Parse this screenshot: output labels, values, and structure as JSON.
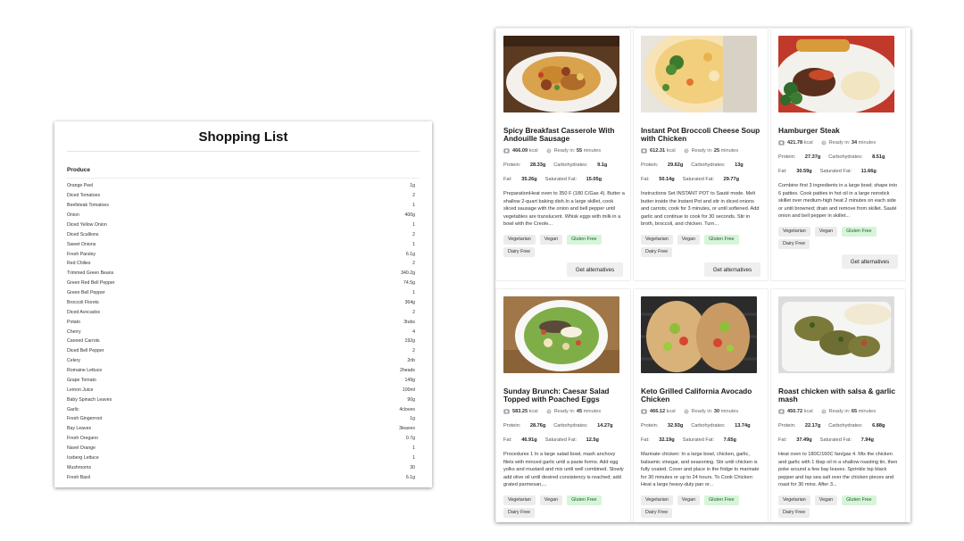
{
  "shopping_list": {
    "title": "Shopping List",
    "category": "Produce",
    "items": [
      {
        "name": "Orange Peel",
        "qty": "1g"
      },
      {
        "name": "Diced Tomatoes",
        "qty": "2"
      },
      {
        "name": "Beefsteak Tomatoes",
        "qty": "1"
      },
      {
        "name": "Onion",
        "qty": "400g"
      },
      {
        "name": "Diced Yellow Onion",
        "qty": "1"
      },
      {
        "name": "Diced Scallions",
        "qty": "2"
      },
      {
        "name": "Sweet Onions",
        "qty": "1"
      },
      {
        "name": "Fresh Parsley",
        "qty": "6.1g"
      },
      {
        "name": "Red Chilies",
        "qty": "2"
      },
      {
        "name": "Trimmed Green Beans",
        "qty": "340.2g"
      },
      {
        "name": "Green Red Bell Pepper",
        "qty": "74.5g"
      },
      {
        "name": "Green Bell Pepper",
        "qty": "1"
      },
      {
        "name": "Broccoli Florets",
        "qty": "364g"
      },
      {
        "name": "Diced Avocados",
        "qty": "2"
      },
      {
        "name": "Potato",
        "qty": "3tubs"
      },
      {
        "name": "Cherry",
        "qty": "4"
      },
      {
        "name": "Canned Carrots",
        "qty": "192g"
      },
      {
        "name": "Diced Bell Pepper",
        "qty": "2"
      },
      {
        "name": "Celery",
        "qty": "2rib"
      },
      {
        "name": "Romaine Lettuce",
        "qty": "2heads"
      },
      {
        "name": "Grape Tomato",
        "qty": "149g"
      },
      {
        "name": "Lemon Juice",
        "qty": "100ml"
      },
      {
        "name": "Baby Spinach Leaves",
        "qty": "90g"
      },
      {
        "name": "Garlic",
        "qty": "4cloves"
      },
      {
        "name": "Fresh Gingerroot",
        "qty": "1g"
      },
      {
        "name": "Bay Leaves",
        "qty": "3leaves"
      },
      {
        "name": "Fresh Oregano",
        "qty": "0.7g"
      },
      {
        "name": "Navel Orange",
        "qty": "1"
      },
      {
        "name": "Iceberg Lettuce",
        "qty": "1"
      },
      {
        "name": "Mushrooms",
        "qty": "30"
      },
      {
        "name": "Fresh Basil",
        "qty": "6.1g"
      }
    ]
  },
  "labels": {
    "ready_in": "Ready in:",
    "minutes": "minutes",
    "kcal": "kcal",
    "protein": "Protein:",
    "carbs": "Carbohydrates:",
    "fat": "Fat:",
    "sat_fat": "Saturated Fat:",
    "alternatives": "Get alternatives"
  },
  "recipes": [
    {
      "title": "Spicy Breakfast Casserole With Andouille Sausage",
      "kcal": "466.09",
      "ready": "55",
      "protein": "28.33g",
      "carbs": "9.1g",
      "fat": "35.26g",
      "sat_fat": "15.05g",
      "description": "PreparationHeat oven to 350 F (180 C/Gas 4). Butter a shallow 2-quart baking dish.In a large skillet, cook sliced sausage with the onion and bell pepper until vegetables are translucent. Whisk eggs with milk in a bowl with the Creole...",
      "tags": [
        "Vegetarian",
        "Vegan",
        "Gluten Free",
        "Dairy Free"
      ],
      "image": "casserole"
    },
    {
      "title": "Instant Pot Broccoli Cheese Soup with Chicken",
      "kcal": "612.31",
      "ready": "25",
      "protein": "29.62g",
      "carbs": "13g",
      "fat": "50.14g",
      "sat_fat": "29.77g",
      "description": "Instructions Set INSTANT POT to Sauté mode. Melt butter inside the Instant Pot and stir in diced onions and carrots; cook for 3 minutes, or until softened. Add garlic and continue to cook for 30 seconds. Stir in broth, broccoli, and chicken. Turn...",
      "tags": [
        "Vegetarian",
        "Vegan",
        "Gluten Free",
        "Dairy Free"
      ],
      "image": "soup"
    },
    {
      "title": "Hamburger Steak",
      "kcal": "421.78",
      "ready": "34",
      "protein": "27.37g",
      "carbs": "8.51g",
      "fat": "30.59g",
      "sat_fat": "11.66g",
      "description": "Combine first 3 ingredients in a large bowl; shape into 6 patties. Cook patties in hot oil in a large nonstick skillet over medium-high heat 2 minutes on each side or until browned; drain and remove from skillet. Sauté onion and bell pepper in skillet...",
      "tags": [
        "Vegetarian",
        "Vegan",
        "Gluten Free",
        "Dairy Free"
      ],
      "image": "steak"
    },
    {
      "title": "Sunday Brunch: Caesar Salad Topped with Poached Eggs",
      "kcal": "583.25",
      "ready": "45",
      "protein": "28.76g",
      "carbs": "14.27g",
      "fat": "46.91g",
      "sat_fat": "12.5g",
      "description": "Procedures 1 In a large salad bowl, mash anchovy filets with minced garlic until a paste forms. Add egg yolks and mustard and mix until well combined. Slowly add olive oil until desired consistency is reached; add grated parmesan,...",
      "tags": [
        "Vegetarian",
        "Vegan",
        "Gluten Free",
        "Dairy Free"
      ],
      "image": "salad"
    },
    {
      "title": "Keto Grilled California Avocado Chicken",
      "kcal": "466.12",
      "ready": "30",
      "protein": "32.93g",
      "carbs": "13.74g",
      "fat": "32.19g",
      "sat_fat": "7.65g",
      "description": "Marinate chicken: In a large bowl, chicken, garlic, balsamic vinegar, and seasoning. Stir until chicken is fully coated. Cover and place in the fridge to marinate for 30 minutes or up to 24 hours. To Cook Chicken: Heat a large heavy-duty pan or...",
      "tags": [
        "Vegetarian",
        "Vegan",
        "Gluten Free",
        "Dairy Free"
      ],
      "image": "avocado"
    },
    {
      "title": "Roast chicken with salsa & garlic mash",
      "kcal": "450.72",
      "ready": "65",
      "protein": "22.17g",
      "carbs": "6.88g",
      "fat": "37.49g",
      "sat_fat": "7.94g",
      "description": "Heat oven to 180C/160C fan/gas 4. Mix the chicken and garlic with 1 tbsp oil in a shallow roasting tin, then poke around a few bay leaves. Sprinkle tsp black pepper and tsp sea salt over the chicken pieces and roast for 30 mins. After 3...",
      "tags": [
        "Vegetarian",
        "Vegan",
        "Gluten Free",
        "Dairy Free"
      ],
      "image": "roast"
    }
  ],
  "colors": {
    "tag_bg": "#ececec",
    "tag_green_bg": "#d6f5d9",
    "button_bg": "#efefef"
  }
}
